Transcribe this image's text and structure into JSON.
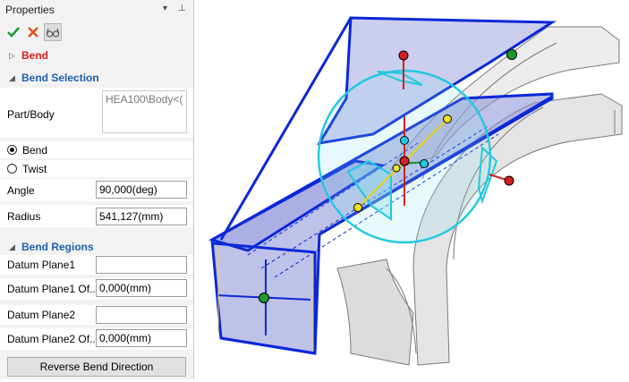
{
  "panel": {
    "title": "Properties",
    "pin_glyph": "▾",
    "close_glyph": "⊥",
    "toolbar": {
      "ok_icon": "check-icon",
      "cancel_icon": "x-icon",
      "preview_icon": "glasses-icon"
    },
    "bend_header": "Bend",
    "bend_selection_header": "Bend Selection",
    "part_body_label": "Part/Body",
    "part_body_value": "HEA100\\Body<(",
    "radio_bend": "Bend",
    "radio_twist": "Twist",
    "bend_selected": true,
    "angle_label": "Angle",
    "angle_value": "90,000(deg)",
    "radius_label": "Radius",
    "radius_value": "541,127(mm)",
    "bend_regions_header": "Bend Regions",
    "datum_plane1_label": "Datum Plane1",
    "datum_plane1_value": "",
    "datum_plane1_offset_label": "Datum Plane1 Of...",
    "datum_plane1_offset_value": "0,000(mm)",
    "datum_plane2_label": "Datum Plane2",
    "datum_plane2_value": "",
    "datum_plane2_offset_label": "Datum Plane2 Of...",
    "datum_plane2_offset_value": "0,000(mm)",
    "reverse_button": "Reverse Bend Direction"
  },
  "colors": {
    "accent_blue": "#1f5fad",
    "bend_red": "#d42020",
    "edge_blue": "#0a28d8",
    "handle_cyan": "#22c8e0"
  }
}
